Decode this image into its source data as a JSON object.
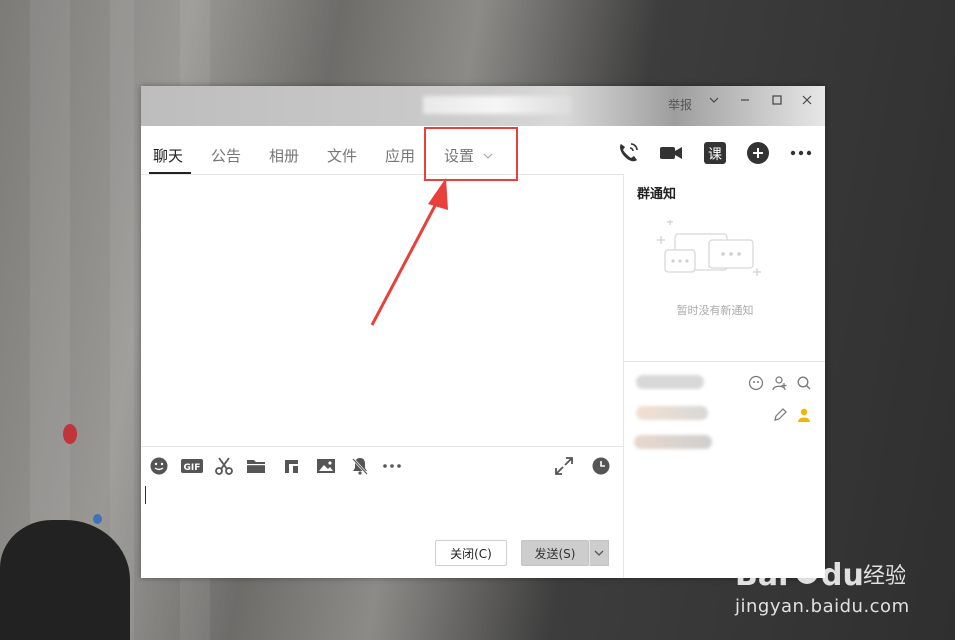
{
  "window": {
    "title_controls": {
      "label": "举报"
    }
  },
  "tabs": [
    {
      "label": "聊天",
      "active": true
    },
    {
      "label": "公告",
      "active": false
    },
    {
      "label": "相册",
      "active": false
    },
    {
      "label": "文件",
      "active": false
    },
    {
      "label": "应用",
      "active": false
    },
    {
      "label": "设置",
      "active": false,
      "has_dropdown": true
    }
  ],
  "toolbar_icons": [
    "voice-call-icon",
    "video-call-icon",
    "class-icon",
    "add-app-icon",
    "more-icon"
  ],
  "format_toolbar_icons": [
    "emoji-icon",
    "gif-icon",
    "scissors-icon",
    "folder-icon",
    "music-icon",
    "image-icon",
    "bell-mute-icon",
    "more-dots-icon"
  ],
  "sidebar": {
    "notice_title": "群通知",
    "notice_empty": "暂时没有新通知"
  },
  "buttons": {
    "close": "关闭(C)",
    "send": "发送(S)"
  },
  "watermark": {
    "logo": "Baidu经验",
    "url": "jingyan.baidu.com"
  },
  "colors": {
    "highlight": "#e8403a",
    "accent_icon": "#333333"
  }
}
